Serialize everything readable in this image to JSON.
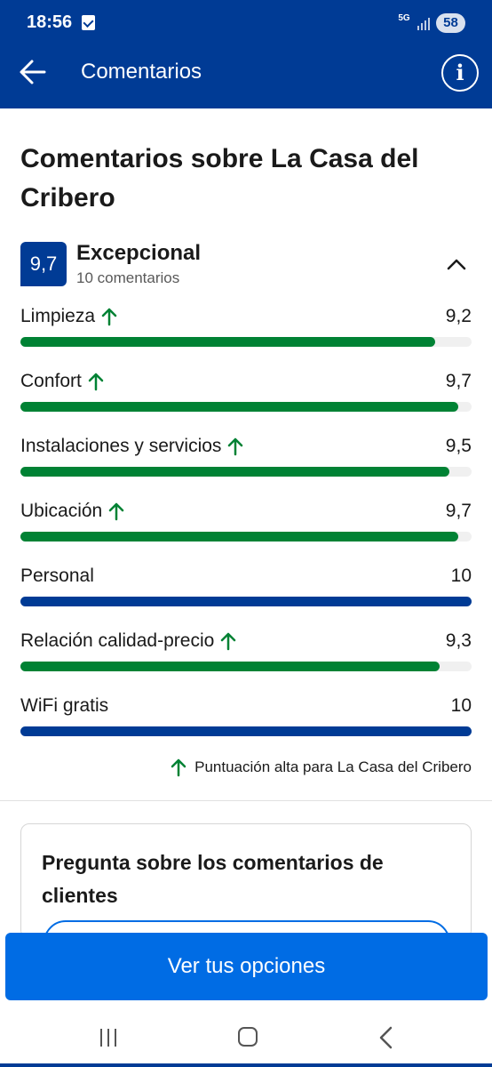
{
  "status_bar": {
    "time": "18:56",
    "network": "5G",
    "battery": "58"
  },
  "header": {
    "title": "Comentarios",
    "back_icon": "arrow-left-icon",
    "info_icon": "info-icon",
    "info_glyph": "i"
  },
  "review_summary": {
    "heading": "Comentarios sobre La Casa del Cribero",
    "score": "9,7",
    "score_label": "Excepcional",
    "review_count": "10 comentarios"
  },
  "categories": [
    {
      "name": "Limpieza",
      "value": "9,2",
      "fraction": 0.92,
      "high": true
    },
    {
      "name": "Confort",
      "value": "9,7",
      "fraction": 0.97,
      "high": true
    },
    {
      "name": "Instalaciones y servicios",
      "value": "9,5",
      "fraction": 0.95,
      "high": true
    },
    {
      "name": "Ubicación",
      "value": "9,7",
      "fraction": 0.97,
      "high": true
    },
    {
      "name": "Personal",
      "value": "10",
      "fraction": 1.0,
      "high": false
    },
    {
      "name": "Relación calidad-precio",
      "value": "9,3",
      "fraction": 0.93,
      "high": true
    },
    {
      "name": "WiFi gratis",
      "value": "10",
      "fraction": 1.0,
      "high": false
    }
  ],
  "high_score_note": "Puntuación alta para La Casa del Cribero",
  "ask_card": {
    "title": "Pregunta sobre los comentarios de clientes"
  },
  "cta": {
    "label": "Ver tus opciones"
  },
  "colors": {
    "brand": "#003b95",
    "high_score": "#008234",
    "cta": "#006ce4"
  }
}
